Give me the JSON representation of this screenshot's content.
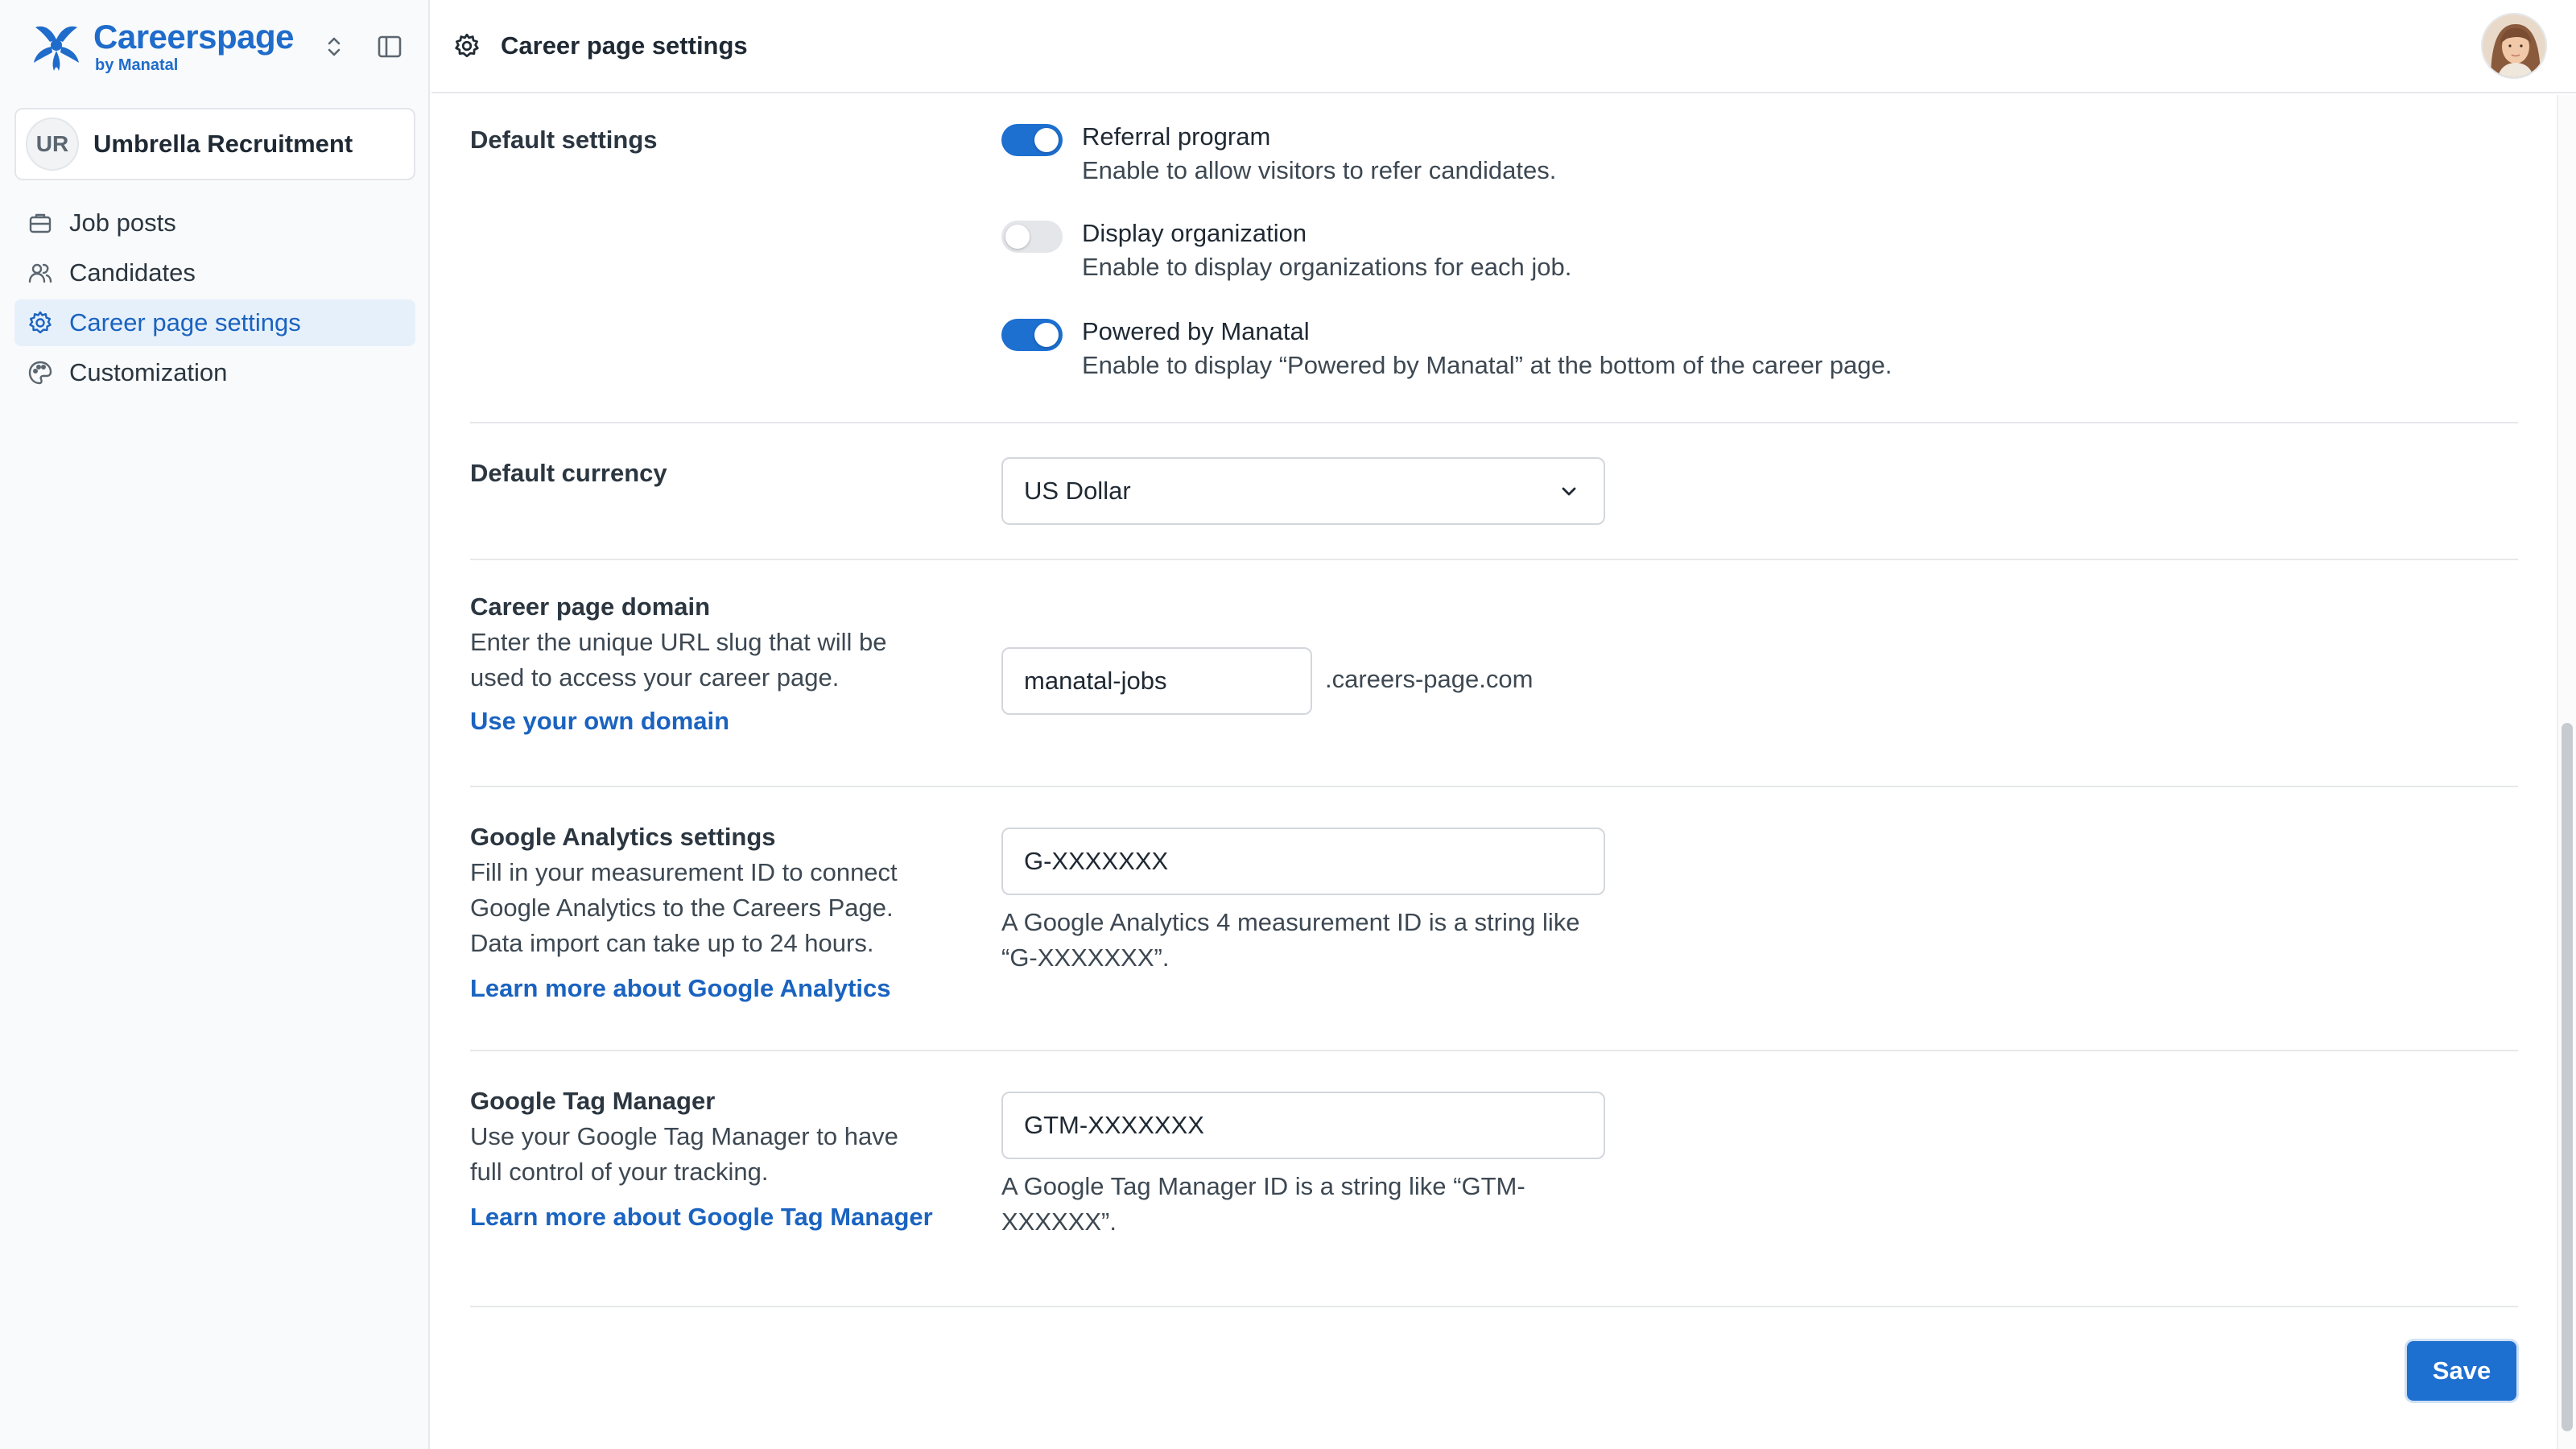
{
  "brand": {
    "name": "Careerspage",
    "sub": "by Manatal",
    "color": "#1f6ccb"
  },
  "organization": {
    "initials": "UR",
    "name": "Umbrella Recruitment"
  },
  "sidebar": {
    "items": [
      {
        "label": "Job posts",
        "icon": "briefcase-icon",
        "active": false
      },
      {
        "label": "Candidates",
        "icon": "users-icon",
        "active": false
      },
      {
        "label": "Career page settings",
        "icon": "gear-icon",
        "active": true
      },
      {
        "label": "Customization",
        "icon": "palette-icon",
        "active": false
      }
    ]
  },
  "header": {
    "title": "Career page settings",
    "icon": "gear-icon"
  },
  "default_settings": {
    "title": "Default settings",
    "toggles": [
      {
        "label": "Referral program",
        "help": "Enable to allow visitors to refer candidates.",
        "on": true
      },
      {
        "label": "Display organization",
        "help": "Enable to display organizations for each job.",
        "on": false
      },
      {
        "label": "Powered by Manatal",
        "help": "Enable to display “Powered by Manatal” at the bottom of the career page.",
        "on": true
      }
    ]
  },
  "default_currency": {
    "title": "Default currency",
    "selected": "US Dollar"
  },
  "career_domain": {
    "title": "Career page domain",
    "description": "Enter the unique URL slug that will be used to access your career page.",
    "link": "Use your own domain",
    "value": "manatal-jobs",
    "suffix": ".careers-page.com"
  },
  "google_analytics": {
    "title": "Google Analytics settings",
    "description": "Fill in your measurement ID to connect Google Analytics to the Careers Page. Data import can take up to 24 hours.",
    "link": "Learn more about Google Analytics",
    "value": "G-XXXXXXX",
    "helper": "A Google Analytics 4 measurement ID is a string like “G-XXXXXXX”."
  },
  "google_tag_manager": {
    "title": "Google Tag Manager",
    "description": "Use your Google Tag Manager to have full control of your tracking.",
    "link": "Learn more about Google Tag Manager",
    "value": "GTM-XXXXXXX",
    "helper": "A Google Tag Manager ID is a string like “GTM-XXXXXX”."
  },
  "actions": {
    "save_label": "Save"
  },
  "colors": {
    "accent": "#1d6fd0",
    "link": "#1a63c0",
    "active_nav_bg": "#e6f0fb"
  }
}
